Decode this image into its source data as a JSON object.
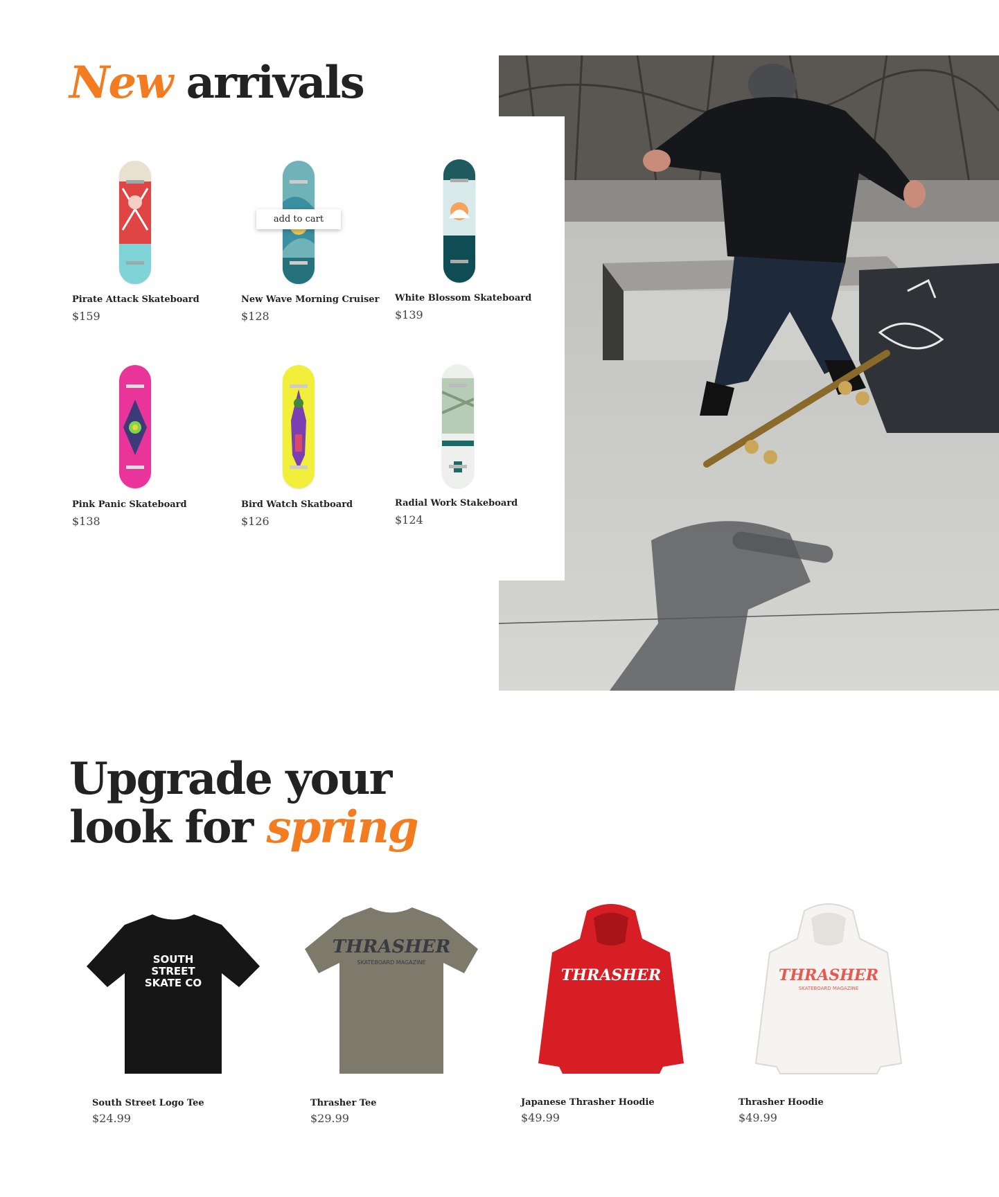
{
  "new_arrivals": {
    "heading_accent": "New",
    "heading_rest": "arrivals",
    "add_to_cart_label": "add to cart",
    "products": [
      {
        "name": "Pirate Attack Skateboard",
        "price": "$159"
      },
      {
        "name": "New Wave Morning Cruiser",
        "price": "$128"
      },
      {
        "name": "White Blossom Skateboard",
        "price": "$139"
      },
      {
        "name": "Pink Panic Skateboard",
        "price": "$138"
      },
      {
        "name": "Bird Watch Skatboard",
        "price": "$126"
      },
      {
        "name": "Radial Work Stakeboard",
        "price": "$124"
      }
    ]
  },
  "spring": {
    "heading_line1": "Upgrade your",
    "heading_line2_prefix": "look for",
    "heading_accent": "spring",
    "products": [
      {
        "name": "South Street Logo Tee",
        "price": "$24.99",
        "print": "SOUTH STREET SKATE CO"
      },
      {
        "name": "Thrasher Tee",
        "price": "$29.99",
        "print": "THRASHER"
      },
      {
        "name": "Japanese Thrasher Hoodie",
        "price": "$49.99",
        "print": "THRASHER"
      },
      {
        "name": "Thrasher Hoodie",
        "price": "$49.99",
        "print": "THRASHER"
      }
    ]
  },
  "colors": {
    "accent": "#f47c20",
    "text": "#222222"
  }
}
